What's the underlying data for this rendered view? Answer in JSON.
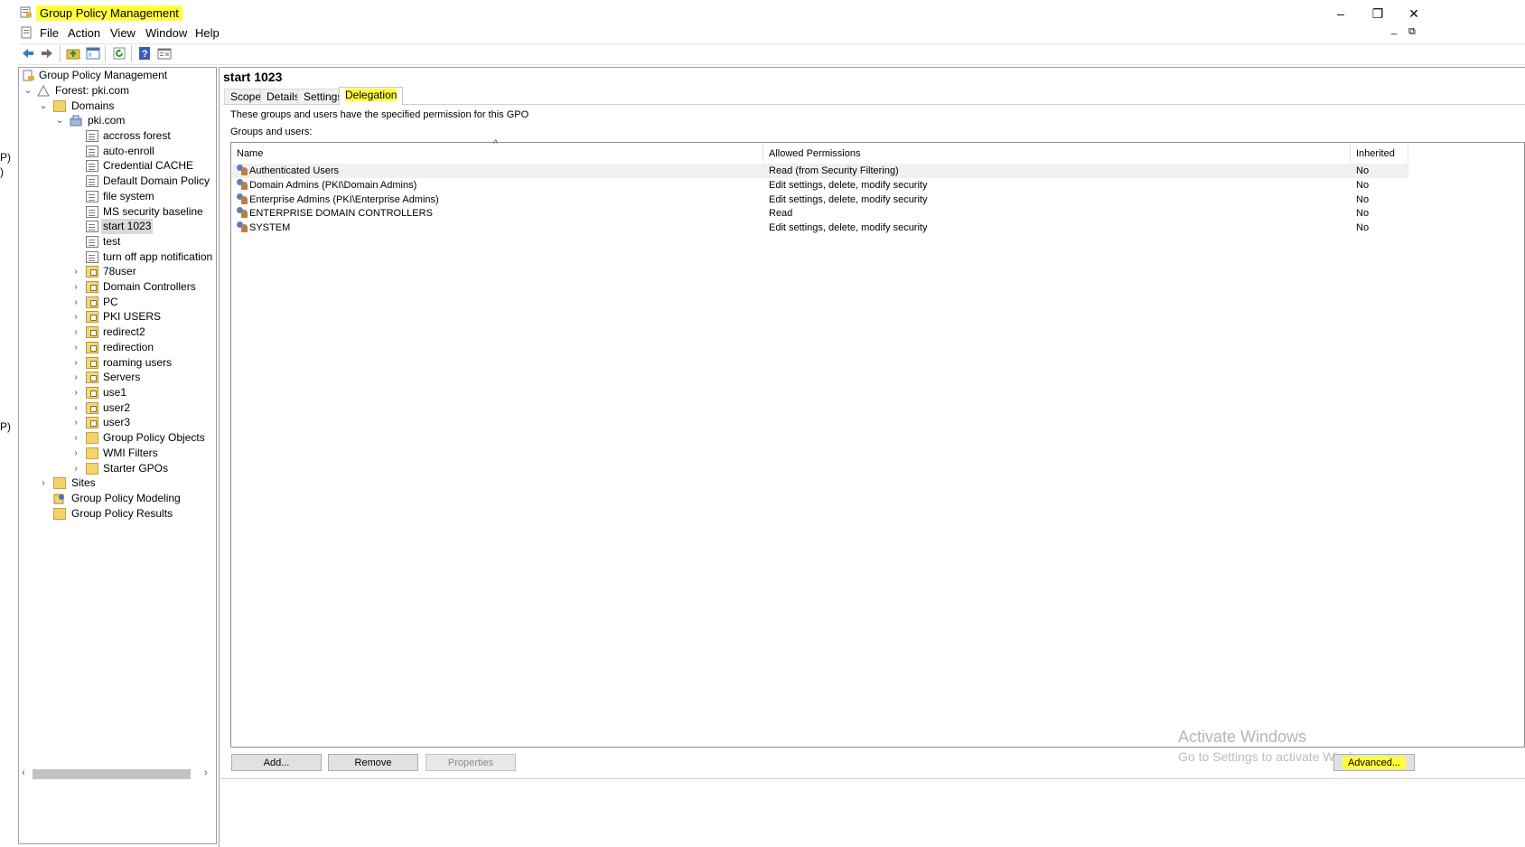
{
  "window": {
    "title": "Group Policy Management",
    "controls": {
      "minimize": "–",
      "restore": "❐",
      "close": "✕"
    },
    "inner_controls": {
      "minimize": "_",
      "restore": "⧉"
    }
  },
  "menu": [
    "File",
    "Action",
    "View",
    "Window",
    "Help"
  ],
  "toolbar": [
    "back-arrow-icon",
    "forward-arrow-icon",
    "up-folder-icon",
    "show-hide-tree-icon",
    "refresh-icon",
    "help-icon",
    "properties-icon"
  ],
  "tree": {
    "root": "Group Policy Management",
    "forest": "Forest: pki.com",
    "domains": "Domains",
    "domain": "pki.com",
    "gpo_links": [
      "accross forest",
      "auto-enroll",
      "Credential CACHE",
      "Default Domain Policy",
      "file system",
      "MS security baseline",
      "start 1023",
      "test",
      "turn off  app notification"
    ],
    "ous": [
      "78user",
      "Domain Controllers",
      "PC",
      "PKI USERS",
      "redirect2",
      "redirection",
      "roaming users",
      "Servers",
      "use1",
      "user2",
      "user3"
    ],
    "containers": [
      "Group Policy Objects",
      "WMI Filters",
      "Starter GPOs"
    ],
    "sites": "Sites",
    "modeling": "Group Policy Modeling",
    "results": "Group Policy Results",
    "selected": "start 1023"
  },
  "left_edge_fragments": [
    "P)",
    ")",
    "P)"
  ],
  "details": {
    "title": "start 1023",
    "tabs": [
      "Scope",
      "Details",
      "Settings",
      "Delegation"
    ],
    "active_tab": "Delegation",
    "description": "These groups and users have the specified permission for this GPO",
    "groups_label": "Groups and users:",
    "columns": [
      "Name",
      "Allowed Permissions",
      "Inherited"
    ],
    "sort_indicator": "^",
    "rows": [
      {
        "name": "Authenticated Users",
        "permissions": "Read (from Security Filtering)",
        "inherited": "No"
      },
      {
        "name": "Domain Admins (PKI\\Domain Admins)",
        "permissions": "Edit settings, delete, modify security",
        "inherited": "No"
      },
      {
        "name": "Enterprise Admins (PKI\\Enterprise Admins)",
        "permissions": "Edit settings, delete, modify security",
        "inherited": "No"
      },
      {
        "name": "ENTERPRISE DOMAIN CONTROLLERS",
        "permissions": "Read",
        "inherited": "No"
      },
      {
        "name": "SYSTEM",
        "permissions": "Edit settings, delete, modify security",
        "inherited": "No"
      }
    ],
    "buttons": {
      "add": "Add...",
      "remove": "Remove",
      "properties": "Properties",
      "advanced": "Advanced..."
    }
  },
  "watermark": {
    "line1": "Activate Windows",
    "line2": "Go to Settings to activate Windows."
  },
  "colors": {
    "highlight": "#ffff3a",
    "selection": "#d9d9d9"
  }
}
